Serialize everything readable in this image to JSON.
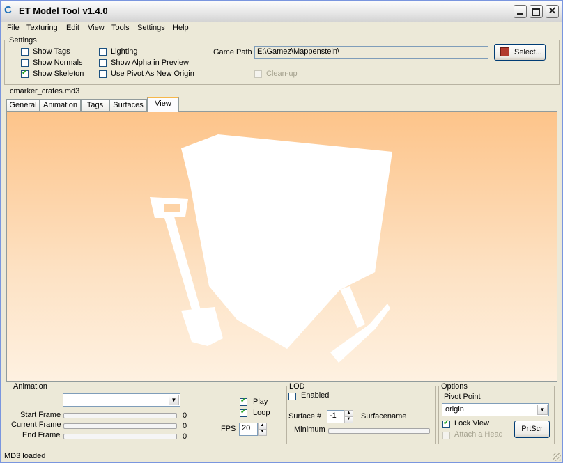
{
  "window": {
    "title": "ET Model Tool v1.4.0",
    "icon": "app-icon",
    "close_glyph": "✕"
  },
  "menu": [
    {
      "underline": "F",
      "rest": "ile"
    },
    {
      "underline": "T",
      "rest": "exturing"
    },
    {
      "underline": "E",
      "rest": "dit"
    },
    {
      "underline": "V",
      "rest": "iew"
    },
    {
      "underline": "T",
      "rest": "ools"
    },
    {
      "underline": "S",
      "rest": "ettings"
    },
    {
      "underline": "H",
      "rest": "elp"
    }
  ],
  "settings": {
    "label": "Settings",
    "show_tags": {
      "label": "Show Tags",
      "checked": false
    },
    "show_normals": {
      "label": "Show Normals",
      "checked": false
    },
    "show_skeleton": {
      "label": "Show Skeleton",
      "checked": true
    },
    "lighting": {
      "label": "Lighting",
      "checked": false
    },
    "show_alpha": {
      "label": "Show Alpha in Preview",
      "checked": false
    },
    "use_pivot": {
      "label": "Use Pivot As New Origin",
      "checked": false
    },
    "game_path_label": "Game Path",
    "game_path_value": "E:\\Gamez\\Mappenstein\\",
    "select_button": "Select...",
    "cleanup": {
      "label": "Clean-up",
      "checked": false,
      "disabled": true
    }
  },
  "model_name": "cmarker_crates.md3",
  "tabs": [
    "General",
    "Animation",
    "Tags",
    "Surfaces",
    "View"
  ],
  "active_tab": "View",
  "animation": {
    "label": "Animation",
    "combo_value": "",
    "start_frame_label": "Start Frame",
    "current_frame_label": "Current Frame",
    "end_frame_label": "End Frame",
    "start_frame_value": "0",
    "current_frame_value": "0",
    "end_frame_value": "0",
    "play": {
      "label": "Play",
      "checked": true
    },
    "loop": {
      "label": "Loop",
      "checked": true
    },
    "fps_label": "FPS",
    "fps_value": "20"
  },
  "lod": {
    "label": "LOD",
    "enabled": {
      "label": "Enabled",
      "checked": false
    },
    "surface_label": "Surface #",
    "surface_value": "-1",
    "surfacename_label": "Surfacename",
    "minimum_label": "Minimum"
  },
  "options": {
    "label": "Options",
    "pivot_label": "Pivot Point",
    "pivot_value": "origin",
    "lock_view": {
      "label": "Lock View",
      "checked": true
    },
    "attach_head": {
      "label": "Attach a Head",
      "checked": false,
      "disabled": true
    },
    "prtscr_button": "PrtScr"
  },
  "status": "MD3 loaded",
  "colors": {
    "viewport_top": "#fdc48a",
    "viewport_bottom": "#fef1e1",
    "model": "#ffffff",
    "active_tab_accent": "#f6b74a"
  }
}
